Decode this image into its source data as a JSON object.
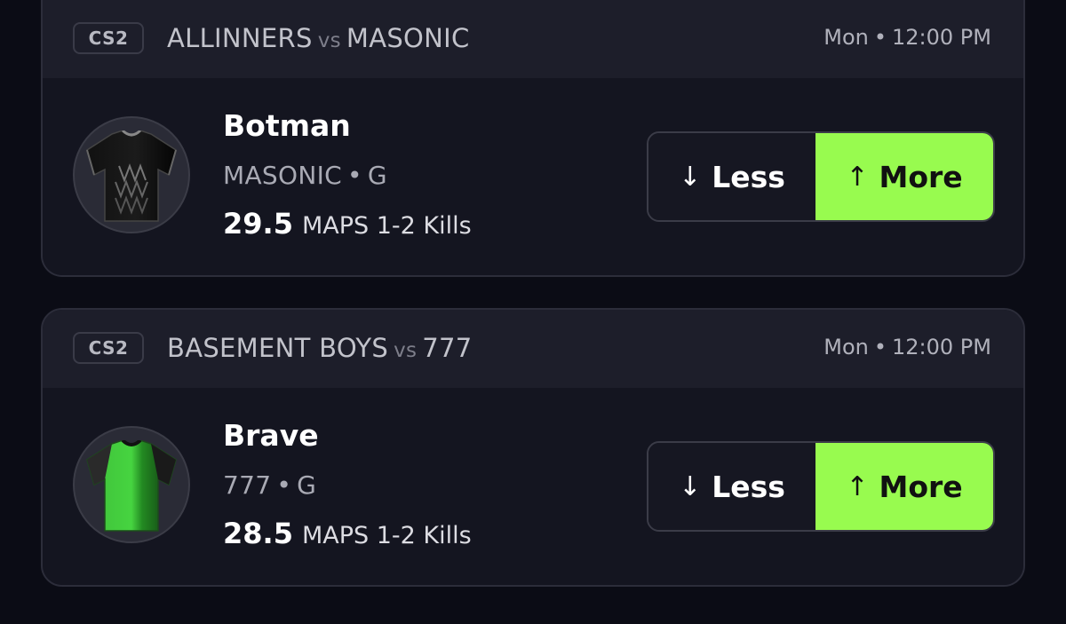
{
  "colors": {
    "background": "#0b0c15",
    "card": "#141520",
    "header": "#1d1e2a",
    "accent_more": "#98fb4f"
  },
  "cards": [
    {
      "game_tag": "CS2",
      "team_a": "ALLINNERS",
      "vs": "vs",
      "team_b": "MASONIC",
      "day": "Mon",
      "time": "12:00 PM",
      "player": {
        "name": "Botman",
        "team": "MASONIC",
        "position": "G",
        "avatar_icon": "black-jersey-icon"
      },
      "stat_value": "29.5",
      "stat_label": "MAPS 1-2 Kills",
      "less_label": "Less",
      "more_label": "More"
    },
    {
      "game_tag": "CS2",
      "team_a": "BASEMENT BOYS",
      "vs": "vs",
      "team_b": "777",
      "day": "Mon",
      "time": "12:00 PM",
      "player": {
        "name": "Brave",
        "team": "777",
        "position": "G",
        "avatar_icon": "green-jersey-icon"
      },
      "stat_value": "28.5",
      "stat_label": "MAPS 1-2 Kills",
      "less_label": "Less",
      "more_label": "More"
    }
  ]
}
